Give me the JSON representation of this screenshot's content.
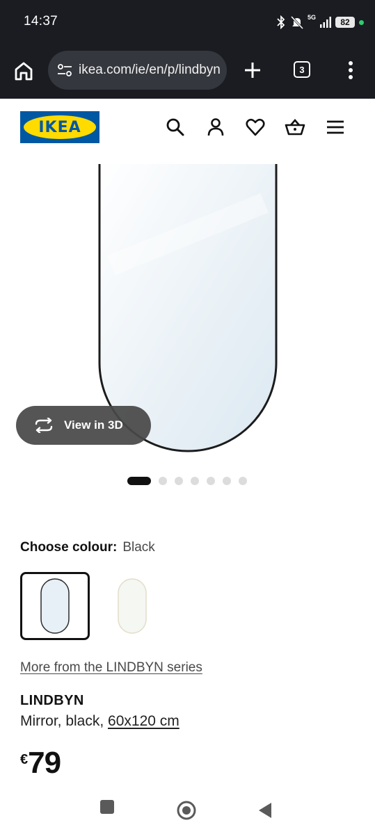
{
  "status_bar": {
    "time": "14:37",
    "battery": "82",
    "network": "5G",
    "icons": [
      "bluetooth-icon",
      "bell-off-icon",
      "signal-icon",
      "battery-icon"
    ]
  },
  "browser": {
    "url": "ikea.com/ie/en/p/lindbyn",
    "tab_count": "3",
    "icons": [
      "home-icon",
      "site-settings-icon",
      "new-tab-plus-icon",
      "more-vert-icon"
    ]
  },
  "site_header": {
    "logo_text": "IKEA",
    "icons": [
      "search-icon",
      "account-icon",
      "heart-icon",
      "basket-icon",
      "hamburger-menu-icon"
    ],
    "colors": {
      "logo_blue": "#0058a3",
      "logo_yellow": "#ffdb00"
    }
  },
  "gallery": {
    "view_3d_label": "View in 3D",
    "total_images": 7,
    "active_index": 0
  },
  "product": {
    "choose_colour_label": "Choose colour:",
    "selected_colour": "Black",
    "colour_options": [
      "Black",
      "White"
    ],
    "series_link": "More from the LINDBYN series",
    "name": "LINDBYN",
    "description_prefix": "Mirror, black, ",
    "size": "60x120 cm",
    "currency": "€",
    "price": "79"
  },
  "nav_bar": {
    "icons": [
      "recents-square-icon",
      "home-circle-icon",
      "back-triangle-icon"
    ]
  }
}
